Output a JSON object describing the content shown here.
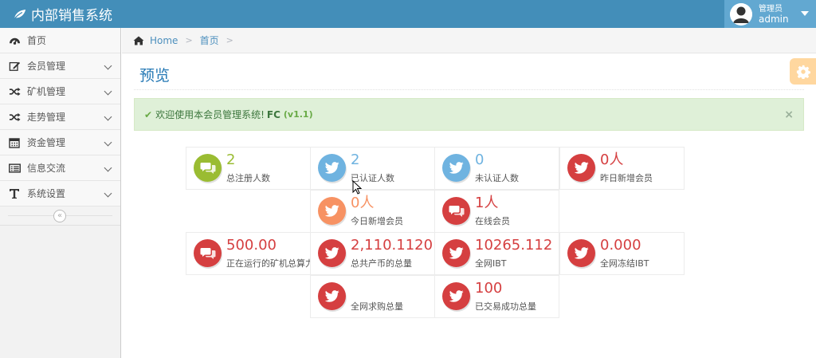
{
  "header": {
    "app_title": "内部销售系统",
    "user_role": "管理员",
    "user_name": "admin"
  },
  "sidebar": {
    "items": [
      {
        "label": "首页",
        "icon": "dashboard-icon"
      },
      {
        "label": "会员管理",
        "icon": "edit-icon"
      },
      {
        "label": "矿机管理",
        "icon": "random-icon"
      },
      {
        "label": "走势管理",
        "icon": "random-icon"
      },
      {
        "label": "资金管理",
        "icon": "calendar-icon"
      },
      {
        "label": "信息交流",
        "icon": "list-icon"
      },
      {
        "label": "系统设置",
        "icon": "text-icon"
      }
    ],
    "collapse_glyph": "«"
  },
  "breadcrumb": {
    "home": "Home",
    "current": "首页",
    "separator": ">"
  },
  "page": {
    "title": "预览"
  },
  "alert": {
    "text": "欢迎使用本会员管理系统!",
    "brand": "FC",
    "version": "(v1.1)",
    "close": "×"
  },
  "stats": [
    {
      "value": "2",
      "label": "总注册人数",
      "color": "#9abc32",
      "icon": "comments-icon"
    },
    {
      "value": "2",
      "label": "已认证人数",
      "color": "#6fb3e0",
      "icon": "twitter-icon"
    },
    {
      "value": "0",
      "label": "未认证人数",
      "color": "#6fb3e0",
      "icon": "twitter-icon"
    },
    {
      "value": "0人",
      "label": "昨日新增会员",
      "color": "#d53f40",
      "icon": "twitter-icon"
    },
    {
      "value": "0人",
      "label": "今日新增会员",
      "color": "#f79263",
      "icon": "twitter-icon"
    },
    {
      "value": "1人",
      "label": "在线会员",
      "color": "#d53f40",
      "icon": "comments-icon"
    },
    {
      "value": "500.00",
      "label": "正在运行的矿机总算力",
      "color": "#d53f40",
      "icon": "comments-icon"
    },
    {
      "value": "2,110.1120",
      "label": "总共产币的总量",
      "color": "#d53f40",
      "icon": "twitter-icon"
    },
    {
      "value": "10265.112",
      "label": "全网IBT",
      "color": "#d53f40",
      "icon": "twitter-icon"
    },
    {
      "value": "0.000",
      "label": "全网冻结IBT",
      "color": "#d53f40",
      "icon": "twitter-icon"
    },
    {
      "value": "",
      "label": "全网求购总量",
      "color": "#d53f40",
      "icon": "twitter-icon"
    },
    {
      "value": "100",
      "label": "已交易成功总量",
      "color": "#d53f40",
      "icon": "twitter-icon"
    }
  ]
}
